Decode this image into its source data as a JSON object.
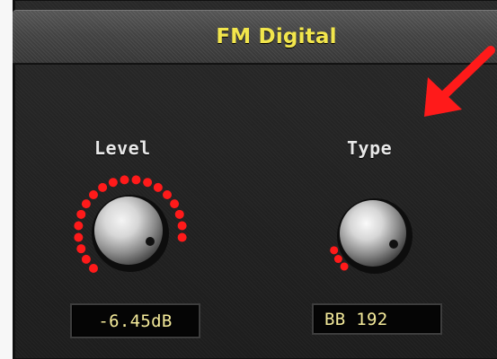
{
  "plugin": {
    "title": "FM Digital"
  },
  "controls": {
    "level": {
      "label": "Level",
      "value_text": "-6.45dB",
      "position_fraction": 0.85
    },
    "type": {
      "label": "Type",
      "value_text": "BB 192",
      "position_fraction": 0.12
    }
  },
  "colors": {
    "title_text": "#f2e64c",
    "label_text": "#e8e8e8",
    "readout_text": "#f4ea9a",
    "knob_ring": "#ff1a1a",
    "annotation_arrow": "#ff1a1a"
  },
  "annotation": {
    "icon": "red-arrow-icon"
  }
}
